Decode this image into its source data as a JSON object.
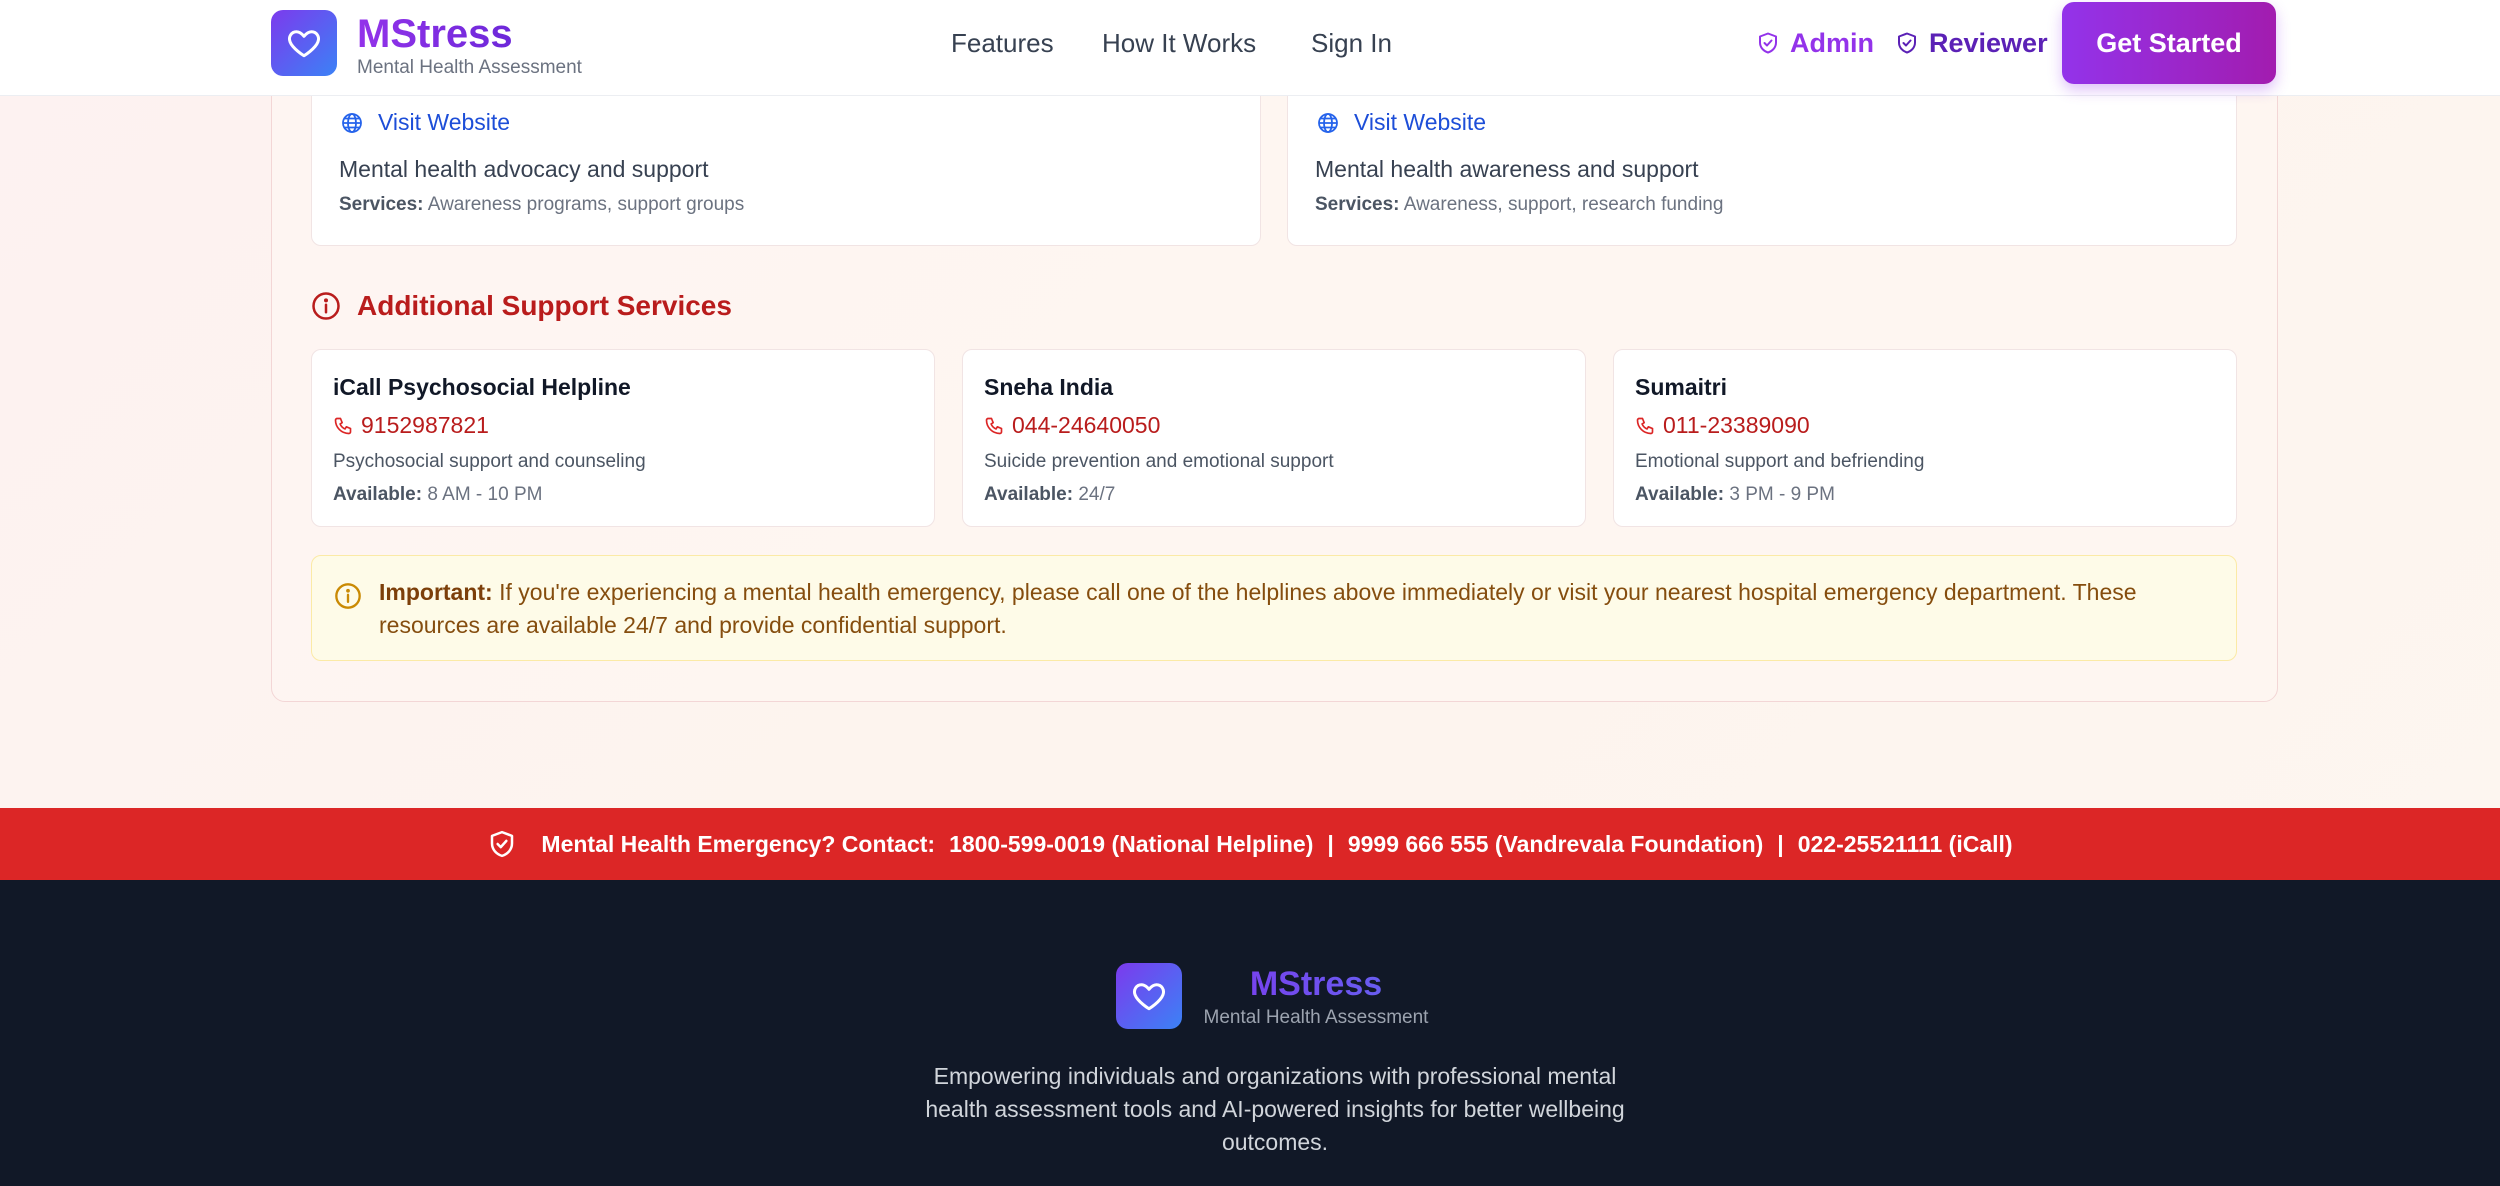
{
  "header": {
    "brand_name": "MStress",
    "brand_subtitle": "Mental Health Assessment",
    "logo_icon": "heart-icon",
    "nav": [
      "Features",
      "How It Works",
      "Sign In"
    ],
    "admin_label": "Admin",
    "reviewer_label": "Reviewer",
    "cta_label": "Get Started"
  },
  "organizations": [
    {
      "link_label": "Visit Website",
      "description": "Mental health advocacy and support",
      "services_label": "Services:",
      "services": "Awareness programs, support groups"
    },
    {
      "link_label": "Visit Website",
      "description": "Mental health awareness and support",
      "services_label": "Services:",
      "services": "Awareness, support, research funding"
    }
  ],
  "additional_services": {
    "title": "Additional Support Services",
    "items": [
      {
        "name": "iCall Psychosocial Helpline",
        "phone": "9152987821",
        "description": "Psychosocial support and counseling",
        "available_label": "Available:",
        "available": "8 AM - 10 PM"
      },
      {
        "name": "Sneha India",
        "phone": "044-24640050",
        "description": "Suicide prevention and emotional support",
        "available_label": "Available:",
        "available": "24/7"
      },
      {
        "name": "Sumaitri",
        "phone": "011-23389090",
        "description": "Emotional support and befriending",
        "available_label": "Available:",
        "available": "3 PM - 9 PM"
      }
    ]
  },
  "important_notice": {
    "label": "Important:",
    "text": "If you're experiencing a mental health emergency, please call one of the helplines above immediately or visit your nearest hospital emergency department. These resources are available 24/7 and provide confidential support."
  },
  "emergency_bar": {
    "label": "Mental Health Emergency? Contact:",
    "contacts": [
      "1800-599-0019 (National Helpline)",
      "9999 666 555 (Vandrevala Foundation)",
      "022-25521111 (iCall)"
    ],
    "separator": "|"
  },
  "footer": {
    "brand_name": "MStress",
    "brand_subtitle": "Mental Health Assessment",
    "tagline": "Empowering individuals and organizations with professional mental health assessment tools and AI-powered insights for better wellbeing outcomes."
  },
  "colors": {
    "brand_purple": "#9333ea",
    "accent_red": "#dc2626",
    "link_blue": "#1d4ed8",
    "footer_bg": "#111827",
    "notice_bg": "#fefbe8"
  }
}
